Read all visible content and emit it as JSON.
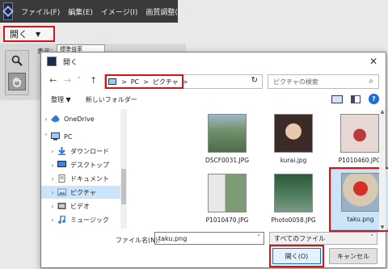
{
  "menubar": {
    "items": [
      "ファイル(F)",
      "編集(E)",
      "イメージ(I)",
      "画質調整(L)"
    ]
  },
  "toolbar": {
    "open_label": "開く",
    "open_arrow": "▼"
  },
  "tools": {
    "view_label": "表示：",
    "view_value": "標準倍率"
  },
  "dialog": {
    "title": "開く",
    "close": "✕",
    "address": {
      "parts": [
        "PC",
        "ピクチャ"
      ],
      "sep": ">"
    },
    "search_placeholder": "ピクチャの検索",
    "commands": {
      "organize": "整理 ▼",
      "new_folder": "新しいフォルダー",
      "help": "?"
    },
    "nav_items": [
      {
        "label": "OneDrive",
        "chev": "›",
        "icon": "cloud-icon",
        "color": "#2a7bd3"
      },
      {
        "label": "PC",
        "chev": "˅",
        "icon": "pc-icon",
        "color": "#5a8fd0"
      },
      {
        "label": "ダウンロード",
        "chev": "›",
        "icon": "download-icon",
        "color": "#2a7bd3"
      },
      {
        "label": "デスクトップ",
        "chev": "›",
        "icon": "desktop-icon",
        "color": "#3a86d8"
      },
      {
        "label": "ドキュメント",
        "chev": "›",
        "icon": "documents-icon",
        "color": "#8a8a8a"
      },
      {
        "label": "ピクチャ",
        "chev": "›",
        "icon": "pictures-icon",
        "color": "#6a8fb8"
      },
      {
        "label": "ビデオ",
        "chev": "›",
        "icon": "video-icon",
        "color": "#6a6a6a"
      },
      {
        "label": "ミュージック",
        "chev": "›",
        "icon": "music-icon",
        "color": "#2a7bd3"
      }
    ],
    "files": [
      {
        "name": "DSCF0031.JPG",
        "color": "#6f8f6a"
      },
      {
        "name": "kurai.jpg",
        "color": "#3a2a28"
      },
      {
        "name": "P1010460.JPG",
        "color": "#c7a0a4"
      },
      {
        "name": "P1010470.JPG",
        "color": "#7d9b74"
      },
      {
        "name": "Photo0058.JPG",
        "color": "#4a7a58"
      },
      {
        "name": "taku.png",
        "color": "#c9665e"
      }
    ],
    "filename_label": "ファイル名(N):",
    "filename_value": "taku.png",
    "filetype_value": "すべてのファイル",
    "open_button": "開く(O)",
    "cancel_button": "キャンセル"
  }
}
